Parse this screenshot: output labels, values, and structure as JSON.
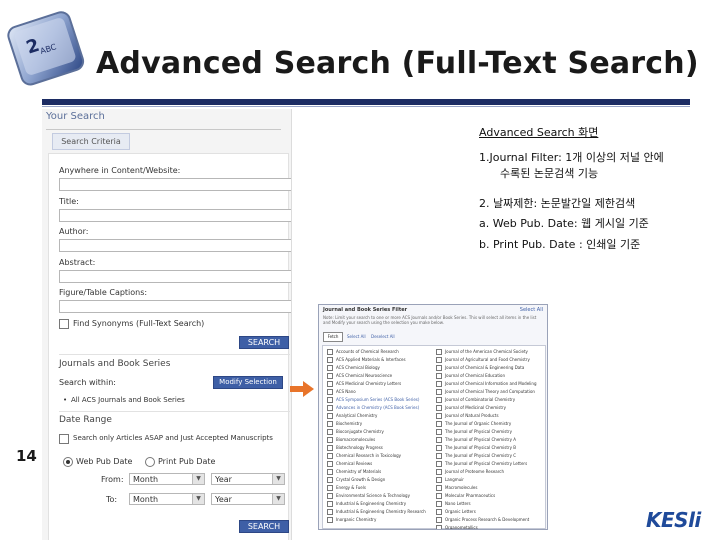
{
  "slide": {
    "title": "Advanced Search (Full-Text Search)",
    "page_number": "14",
    "brand": "KESli"
  },
  "search_panel": {
    "header": "Your Search",
    "tab": "Search Criteria",
    "fields": [
      {
        "label": "Anywhere in Content/Website:"
      },
      {
        "label": "Title:"
      },
      {
        "label": "Author:"
      },
      {
        "label": "Abstract:"
      },
      {
        "label": "Figure/Table Captions:"
      }
    ],
    "synonyms_label": "Find Synonyms (Full-Text Search)",
    "search_button": "SEARCH",
    "journals_section": "Journals and Book Series",
    "search_within": "Search within:",
    "modify_button": "Modify Selection",
    "all_journals": "All ACS Journals and Book Series",
    "date_range": "Date Range",
    "asap_label": "Search only Articles ASAP and Just Accepted Manuscripts",
    "web_pub": "Web Pub Date",
    "print_pub": "Print Pub Date",
    "from_label": "From:",
    "to_label": "To:",
    "month": "Month",
    "year": "Year",
    "search_button_2": "SEARCH"
  },
  "description": {
    "heading": "Advanced Search 화면",
    "line1": "1.Journal Filter: 1개 이상의 저널 안에",
    "line1b": "수록된 논문검색 기능",
    "line2": "2. 날짜제한: 논문발간일 제한검색",
    "line2a": "a. Web Pub. Date: 웹 게시일 기준",
    "line2b": "b. Print Pub. Date : 인쇄일 기준"
  },
  "filter_dialog": {
    "title": "Journal and Book Series Filter",
    "close": "Select All",
    "note": "Note: Limit your search to one or more ACS Journals and/or Book Series. This will select all items in the list and Modify your search using the selection you make below.",
    "button": "Fetch",
    "select_all": "Select All",
    "deselect_all": "Deselect All",
    "left_items": [
      "Accounts of Chemical Research",
      "ACS Applied Materials & Interfaces",
      "ACS Chemical Biology",
      "ACS Chemical Neuroscience",
      "ACS Medicinal Chemistry Letters",
      "ACS Nano",
      "ACS Symposium Series (ACS Book Series)",
      "Advances in Chemistry (ACS Book Series)",
      "Analytical Chemistry",
      "Biochemistry",
      "Bioconjugate Chemistry",
      "Biomacromolecules",
      "Biotechnology Progress",
      "Chemical Research in Toxicology",
      "Chemical Reviews",
      "Chemistry of Materials",
      "Crystal Growth & Design",
      "Energy & Fuels",
      "Environmental Science & Technology",
      "Industrial & Engineering Chemistry",
      "Industrial & Engineering Chemistry Research",
      "Inorganic Chemistry"
    ],
    "right_items": [
      "Journal of the American Chemical Society",
      "Journal of Agricultural and Food Chemistry",
      "Journal of Chemical & Engineering Data",
      "Journal of Chemical Education",
      "Journal of Chemical Information and Modeling",
      "Journal of Chemical Theory and Computation",
      "Journal of Combinatorial Chemistry",
      "Journal of Medicinal Chemistry",
      "Journal of Natural Products",
      "The Journal of Organic Chemistry",
      "The Journal of Physical Chemistry",
      "The Journal of Physical Chemistry A",
      "The Journal of Physical Chemistry B",
      "The Journal of Physical Chemistry C",
      "The Journal of Physical Chemistry Letters",
      "Journal of Proteome Research",
      "Langmuir",
      "Macromolecules",
      "Molecular Pharmaceutics",
      "Nano Letters",
      "Organic Letters",
      "Organic Process Research & Development",
      "Organometallics"
    ]
  },
  "colors": {
    "accent_bar": "#1c2c63",
    "button": "#3e5fa6",
    "arrow": "#e8742a",
    "brand": "#1f4a9a"
  }
}
